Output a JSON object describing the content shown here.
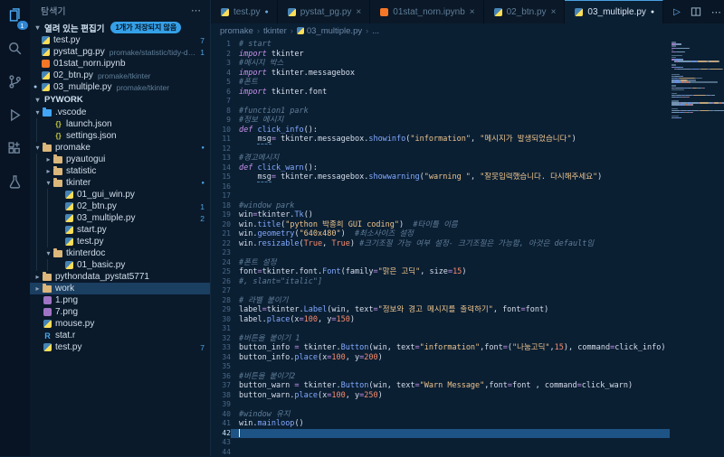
{
  "icons": {
    "chevron_down": "▾",
    "chevron_right": "▸",
    "more": "⋯",
    "close": "×",
    "dot": "●",
    "crumb_sep": "›",
    "run": "▷"
  },
  "activity_bar": {
    "items": [
      {
        "name": "explorer",
        "icon": "files",
        "active": true,
        "badge": "1"
      },
      {
        "name": "search",
        "icon": "search",
        "active": false
      },
      {
        "name": "source-control",
        "icon": "scm",
        "active": false
      },
      {
        "name": "run-debug",
        "icon": "debug",
        "active": false
      },
      {
        "name": "extensions",
        "icon": "extensions",
        "active": false
      },
      {
        "name": "testing",
        "icon": "flask",
        "active": false
      }
    ]
  },
  "sidebar": {
    "title": "탐색기",
    "open_editors": {
      "label": "열려 있는 편집기",
      "badge": "1개가 저장되지 않음",
      "items": [
        {
          "label": "test.py",
          "icon": "py",
          "badge": "7"
        },
        {
          "label": "pystat_pg.py",
          "icon": "py",
          "desc": "promake/statistic/tidy-data-python-...",
          "badge": "1"
        },
        {
          "label": "01stat_norn.ipynb",
          "icon": "ipynb"
        },
        {
          "label": "02_btn.py",
          "icon": "py",
          "desc": "promake/tkinter"
        },
        {
          "label": "03_multiple.py",
          "icon": "py",
          "desc": "promake/tkinter",
          "modified": true
        }
      ]
    },
    "workspace": {
      "label": "PYWORK",
      "items": [
        {
          "label": ".vscode",
          "kind": "folder",
          "depth": 1,
          "expanded": true,
          "special": "vscode"
        },
        {
          "label": "launch.json",
          "kind": "file",
          "icon": "json",
          "depth": 2
        },
        {
          "label": "settings.json",
          "kind": "file",
          "icon": "json",
          "depth": 2
        },
        {
          "label": "promake",
          "kind": "folder",
          "depth": 1,
          "expanded": true,
          "dot": true
        },
        {
          "label": "pyautogui",
          "kind": "folder",
          "depth": 2,
          "expanded": false
        },
        {
          "label": "statistic",
          "kind": "folder",
          "depth": 2,
          "expanded": false
        },
        {
          "label": "tkinter",
          "kind": "folder",
          "depth": 2,
          "expanded": true,
          "dot": true
        },
        {
          "label": "01_gui_win.py",
          "kind": "file",
          "icon": "py",
          "depth": 3
        },
        {
          "label": "02_btn.py",
          "kind": "file",
          "icon": "py",
          "depth": 3,
          "badge": "1"
        },
        {
          "label": "03_multiple.py",
          "kind": "file",
          "icon": "py",
          "depth": 3,
          "badge": "2"
        },
        {
          "label": "start.py",
          "kind": "file",
          "icon": "py",
          "depth": 3
        },
        {
          "label": "test.py",
          "kind": "file",
          "icon": "py",
          "depth": 3
        },
        {
          "label": "tkinterdoc",
          "kind": "folder",
          "depth": 2,
          "expanded": true
        },
        {
          "label": "01_basic.py",
          "kind": "file",
          "icon": "py",
          "depth": 3
        },
        {
          "label": "pythondata_pystat5771",
          "kind": "folder",
          "depth": 1,
          "expanded": false
        },
        {
          "label": "work",
          "kind": "folder",
          "depth": 1,
          "expanded": false,
          "selected": true
        },
        {
          "label": "1.png",
          "kind": "file",
          "icon": "img",
          "depth": 1
        },
        {
          "label": "7.png",
          "kind": "file",
          "icon": "img",
          "depth": 1
        },
        {
          "label": "mouse.py",
          "kind": "file",
          "icon": "py",
          "depth": 1
        },
        {
          "label": "stat.r",
          "kind": "file",
          "icon": "r",
          "depth": 1
        },
        {
          "label": "test.py",
          "kind": "file",
          "icon": "py",
          "depth": 1,
          "badge": "7"
        }
      ]
    }
  },
  "tabs": [
    {
      "label": "test.py",
      "icon": "py",
      "modified": true,
      "active": false
    },
    {
      "label": "pystat_pg.py",
      "icon": "py",
      "close": true,
      "active": false
    },
    {
      "label": "01stat_norn.ipynb",
      "icon": "ipynb",
      "close": true,
      "active": false
    },
    {
      "label": "02_btn.py",
      "icon": "py",
      "close": true,
      "active": false
    },
    {
      "label": "03_multiple.py",
      "icon": "py",
      "modified": true,
      "active": true
    }
  ],
  "editor_actions": [
    {
      "name": "run",
      "glyph": "▷"
    },
    {
      "name": "split-editor",
      "glyph": ""
    },
    {
      "name": "more-actions",
      "glyph": "⋯"
    }
  ],
  "breadcrumb": {
    "items": [
      {
        "label": "promake"
      },
      {
        "label": "tkinter"
      },
      {
        "label": "03_multiple.py",
        "icon": "py"
      },
      {
        "label": "..."
      }
    ]
  },
  "editor": {
    "active_line": 42,
    "lines": [
      [
        [
          "c",
          "# start"
        ]
      ],
      [
        [
          "k",
          "import"
        ],
        [
          "t",
          " tkinter"
        ]
      ],
      [
        [
          "c",
          "#메시지 박스"
        ]
      ],
      [
        [
          "k",
          "import"
        ],
        [
          "t",
          " tkinter.messagebox"
        ]
      ],
      [
        [
          "c",
          "#폰트"
        ]
      ],
      [
        [
          "k",
          "import"
        ],
        [
          "t",
          " tkinter.font"
        ]
      ],
      [],
      [
        [
          "c",
          "#function1 park"
        ]
      ],
      [
        [
          "c",
          "#정보 메시지"
        ]
      ],
      [
        [
          "k",
          "def "
        ],
        [
          "f",
          "click_info"
        ],
        [
          "t",
          "():"
        ]
      ],
      [
        [
          "t",
          "    "
        ],
        [
          "u",
          "msg"
        ],
        [
          "o",
          "="
        ],
        [
          "t",
          " tkinter.messagebox."
        ],
        [
          "f",
          "showinfo"
        ],
        [
          "t",
          "("
        ],
        [
          "s",
          "\"information\""
        ],
        [
          "t",
          ", "
        ],
        [
          "s",
          "\"메시지가 발생되었습니다\""
        ],
        [
          "t",
          ")"
        ]
      ],
      [],
      [
        [
          "c",
          "#경고메시지"
        ]
      ],
      [
        [
          "k",
          "def "
        ],
        [
          "f",
          "click_warn"
        ],
        [
          "t",
          "():"
        ]
      ],
      [
        [
          "t",
          "    "
        ],
        [
          "u",
          "msg"
        ],
        [
          "o",
          "="
        ],
        [
          "t",
          " tkinter.messagebox."
        ],
        [
          "f",
          "showwarning"
        ],
        [
          "t",
          "("
        ],
        [
          "s",
          "\"warning \""
        ],
        [
          "t",
          ", "
        ],
        [
          "s",
          "\"잘못입력했습니다. 다시해주세요\""
        ],
        [
          "t",
          ")"
        ]
      ],
      [],
      [],
      [
        [
          "c",
          "#window park"
        ]
      ],
      [
        [
          "t",
          "win"
        ],
        [
          "o",
          "="
        ],
        [
          "t",
          "tkinter."
        ],
        [
          "f",
          "Tk"
        ],
        [
          "t",
          "()"
        ]
      ],
      [
        [
          "t",
          "win."
        ],
        [
          "f",
          "title"
        ],
        [
          "t",
          "("
        ],
        [
          "s",
          "\"python 박종희 GUI coding\""
        ],
        [
          "t",
          ")"
        ],
        [
          "c",
          "  #타이틀 이름"
        ]
      ],
      [
        [
          "t",
          "win."
        ],
        [
          "f",
          "geometry"
        ],
        [
          "t",
          "("
        ],
        [
          "s",
          "\"640x480\""
        ],
        [
          "t",
          ")"
        ],
        [
          "c",
          "  #최소사이즈 설정"
        ]
      ],
      [
        [
          "t",
          "win."
        ],
        [
          "f",
          "resizable"
        ],
        [
          "t",
          "("
        ],
        [
          "b",
          "True"
        ],
        [
          "t",
          ", "
        ],
        [
          "b",
          "True"
        ],
        [
          "t",
          ") "
        ],
        [
          "c",
          "#크기조절 가능 여부 설정- 크기조절은 가능함, 아것은 default임"
        ]
      ],
      [],
      [
        [
          "c",
          "#폰트 설정"
        ]
      ],
      [
        [
          "t",
          "font"
        ],
        [
          "o",
          "="
        ],
        [
          "t",
          "tkinter.font."
        ],
        [
          "f",
          "Font"
        ],
        [
          "t",
          "(family"
        ],
        [
          "o",
          "="
        ],
        [
          "s",
          "\"맑은 고딕\""
        ],
        [
          "t",
          ", size"
        ],
        [
          "o",
          "="
        ],
        [
          "n",
          "15"
        ],
        [
          "t",
          ")"
        ]
      ],
      [
        [
          "c",
          "#, slant=\"italic\"]"
        ]
      ],
      [],
      [
        [
          "c",
          "# 라벨 붙이기"
        ]
      ],
      [
        [
          "t",
          "label"
        ],
        [
          "o",
          "="
        ],
        [
          "t",
          "tkinter."
        ],
        [
          "f",
          "Label"
        ],
        [
          "t",
          "(win, text"
        ],
        [
          "o",
          "="
        ],
        [
          "s",
          "\"정보와 경고 메시지를 출력하기\""
        ],
        [
          "t",
          ", font"
        ],
        [
          "o",
          "="
        ],
        [
          "t",
          "font)"
        ]
      ],
      [
        [
          "t",
          "label."
        ],
        [
          "f",
          "place"
        ],
        [
          "t",
          "(x"
        ],
        [
          "o",
          "="
        ],
        [
          "n",
          "100"
        ],
        [
          "t",
          ", y"
        ],
        [
          "o",
          "="
        ],
        [
          "n",
          "150"
        ],
        [
          "t",
          ")"
        ]
      ],
      [],
      [
        [
          "c",
          "#버튼을 붙이기 1"
        ]
      ],
      [
        [
          "t",
          "button_info "
        ],
        [
          "o",
          "="
        ],
        [
          "t",
          " tkinter."
        ],
        [
          "f",
          "Button"
        ],
        [
          "t",
          "(win, text"
        ],
        [
          "o",
          "="
        ],
        [
          "s",
          "\"information\""
        ],
        [
          "t",
          ",font"
        ],
        [
          "o",
          "="
        ],
        [
          "t",
          "("
        ],
        [
          "s",
          "\"나눔고딕\""
        ],
        [
          "t",
          ","
        ],
        [
          "n",
          "15"
        ],
        [
          "t",
          "), command"
        ],
        [
          "o",
          "="
        ],
        [
          "t",
          "click_info)"
        ]
      ],
      [
        [
          "t",
          "button_info."
        ],
        [
          "f",
          "place"
        ],
        [
          "t",
          "(x"
        ],
        [
          "o",
          "="
        ],
        [
          "n",
          "100"
        ],
        [
          "t",
          ", y"
        ],
        [
          "o",
          "="
        ],
        [
          "n",
          "200"
        ],
        [
          "t",
          ")"
        ]
      ],
      [],
      [
        [
          "c",
          "#버튼을 붙이기2"
        ]
      ],
      [
        [
          "t",
          "button_warn "
        ],
        [
          "o",
          "="
        ],
        [
          "t",
          " tkinter."
        ],
        [
          "f",
          "Button"
        ],
        [
          "t",
          "(win, text"
        ],
        [
          "o",
          "="
        ],
        [
          "s",
          "\"Warn Message\""
        ],
        [
          "t",
          ",font"
        ],
        [
          "o",
          "="
        ],
        [
          "t",
          "font , command"
        ],
        [
          "o",
          "="
        ],
        [
          "t",
          "click_warn)"
        ]
      ],
      [
        [
          "t",
          "button_warn."
        ],
        [
          "f",
          "place"
        ],
        [
          "t",
          "(x"
        ],
        [
          "o",
          "="
        ],
        [
          "n",
          "100"
        ],
        [
          "t",
          ", y"
        ],
        [
          "o",
          "="
        ],
        [
          "n",
          "250"
        ],
        [
          "t",
          ")"
        ]
      ],
      [],
      [
        [
          "c",
          "#window 유지"
        ]
      ],
      [
        [
          "t",
          "win."
        ],
        [
          "f",
          "mainloop"
        ],
        [
          "t",
          "()"
        ]
      ],
      [],
      [],
      []
    ]
  }
}
